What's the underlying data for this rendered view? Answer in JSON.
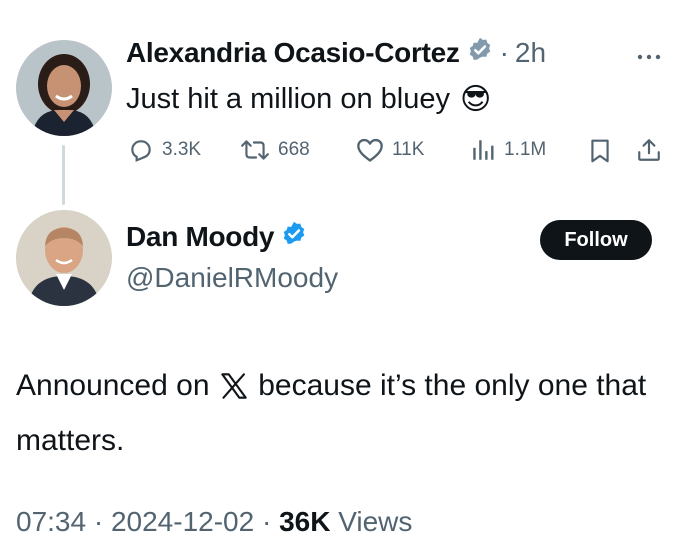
{
  "quoted_post": {
    "author_name": "Alexandria Ocasio-Cortez",
    "verified_icon": "gray-verified-badge-icon",
    "separator": "·",
    "time": "2h",
    "more_icon": "more-icon",
    "text": "Just hit a million on bluey",
    "emoji": "😎",
    "actions": {
      "replies": "3.3K",
      "reposts": "668",
      "likes": "11K",
      "views": "1.1M"
    }
  },
  "main_post": {
    "author_name": "Dan Moody",
    "handle": "@DanielRMoody",
    "verified_icon": "blue-verified-badge-icon",
    "follow_label": "Follow",
    "text_before_logo": "Announced on",
    "logo_icon": "x-logo-icon",
    "text_after_logo": "because it’s the only one that matters.",
    "timestamp": "07:34 · 2024-12-02 ·",
    "views_count": "36K",
    "views_label": "Views"
  },
  "colors": {
    "text": "#0f1419",
    "muted": "#536471",
    "verified_blue": "#1d9bf0",
    "verified_gray": "#829aab",
    "follow_button_bg": "#0f1419"
  }
}
